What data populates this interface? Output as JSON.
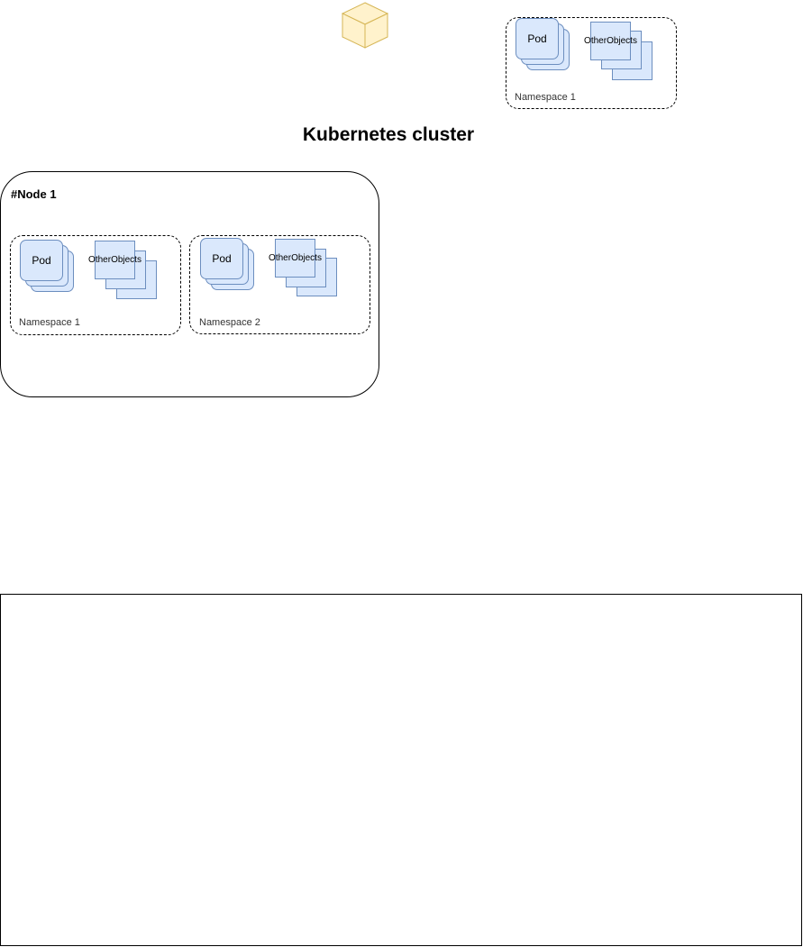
{
  "cluster": {
    "title": "Kubernetes cluster"
  },
  "legend": {
    "namespace_label": "Namespace 1",
    "pod_label": "Pod",
    "objects_label": [
      "Other",
      "Objects"
    ]
  },
  "node": {
    "title": "#Node 1",
    "namespaces": [
      {
        "label": "Namespace 1",
        "pod_label": "Pod",
        "objects_label": [
          "Other",
          "Objects"
        ]
      },
      {
        "label": "Namespace 2",
        "pod_label": "Pod",
        "objects_label": [
          "Other",
          "Objects"
        ]
      }
    ]
  },
  "colors": {
    "pod_fill": "#dae8fc",
    "pod_stroke": "#6c8ebf",
    "cube_fill": "#fff2cc",
    "cube_stroke": "#d6b656"
  },
  "icons": {
    "cube": "cube-icon"
  }
}
